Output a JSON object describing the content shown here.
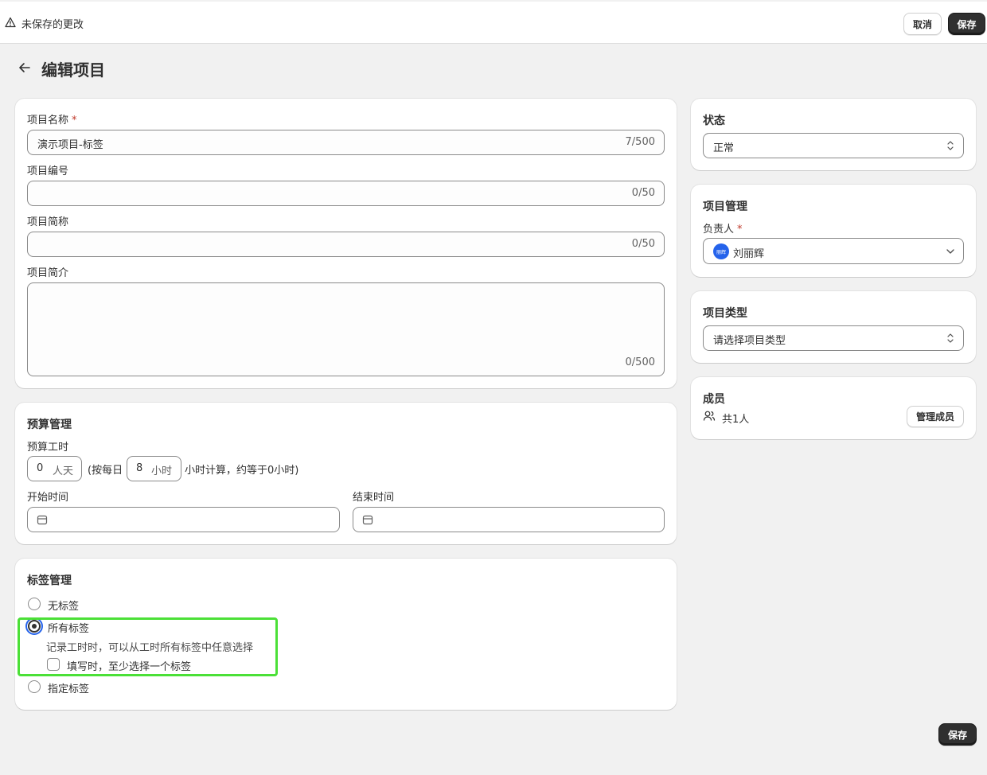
{
  "topbar": {
    "unsaved_text": "未保存的更改",
    "cancel_label": "取消",
    "save_label": "保存"
  },
  "page": {
    "title": "编辑项目",
    "bottom_save_label": "保存"
  },
  "basic_info": {
    "name_label": "项目名称",
    "required_mark": "*",
    "name_value": "演示项目-标签",
    "name_count": "7/500",
    "code_label": "项目编号",
    "code_value": "",
    "code_count": "0/50",
    "short_label": "项目简称",
    "short_value": "",
    "short_count": "0/50",
    "intro_label": "项目简介",
    "intro_value": "",
    "intro_count": "0/500"
  },
  "budget": {
    "title": "预算管理",
    "hours_label": "预算工时",
    "days_value": "0",
    "days_unit": "人天",
    "per_day_prefix": "(按每日",
    "hours_per_day_value": "8",
    "hours_unit": "小时",
    "per_day_suffix": "小时计算，约等于0小时)",
    "start_label": "开始时间",
    "end_label": "结束时间"
  },
  "tags": {
    "title": "标签管理",
    "options": [
      {
        "label": "无标签",
        "checked": false
      },
      {
        "label": "所有标签",
        "checked": true,
        "description": "记录工时时，可以从工时所有标签中任意选择",
        "sub_checkbox": "填写时，至少选择一个标签"
      },
      {
        "label": "指定标签",
        "checked": false
      }
    ]
  },
  "status": {
    "title": "状态",
    "selected": "正常"
  },
  "management": {
    "title": "项目管理",
    "owner_label": "负责人",
    "required_mark": "*",
    "owner_avatar_text": "丽辉",
    "owner_name": "刘丽辉"
  },
  "project_type": {
    "title": "项目类型",
    "placeholder": "请选择项目类型"
  },
  "members": {
    "title": "成员",
    "count_text": "共1人",
    "manage_label": "管理成员"
  },
  "colors": {
    "accent": "#303030",
    "focus_ring": "#2563eb",
    "highlight": "#4be037",
    "avatar": "#2563eb"
  }
}
